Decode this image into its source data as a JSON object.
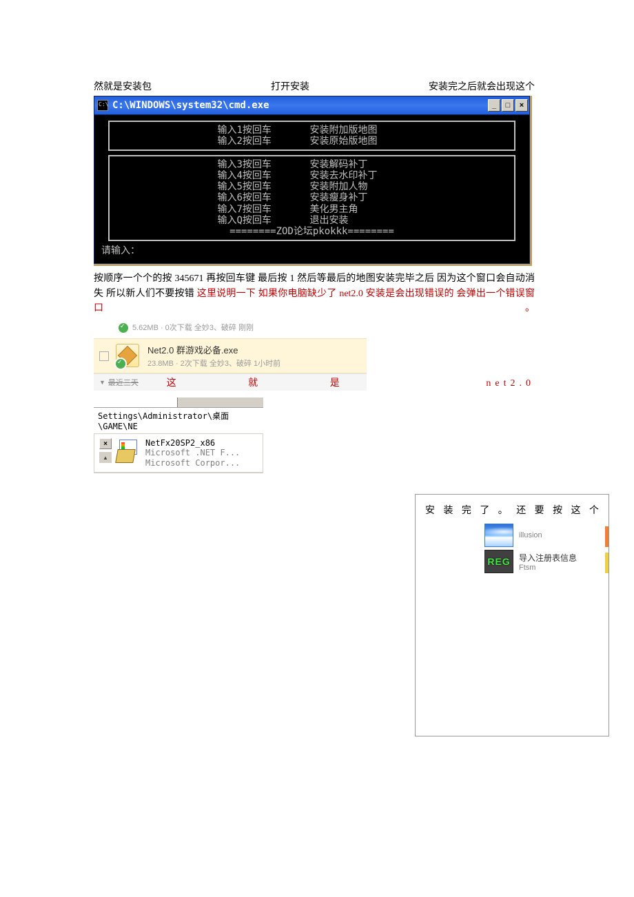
{
  "intro": {
    "seg1": "然就是安装包",
    "seg2": "打开安装",
    "seg3": "安装完之后就会出现这个"
  },
  "cmd": {
    "title": "C:\\WINDOWS\\system32\\cmd.exe",
    "min": "_",
    "max": "□",
    "close": "×",
    "frame1": [
      {
        "l": "输入1按回车",
        "r": "安装附加版地图"
      },
      {
        "l": "输入2按回车",
        "r": "安装原始版地图"
      }
    ],
    "frame2": [
      {
        "l": "输入3按回车",
        "r": "安装解码补丁"
      },
      {
        "l": "输入4按回车",
        "r": "安装去水印补丁"
      },
      {
        "l": "输入5按回车",
        "r": "安装附加人物"
      },
      {
        "l": "输入6按回车",
        "r": "安装瘦身补丁"
      },
      {
        "l": "输入7按回车",
        "r": "美化男主角"
      },
      {
        "l": "输入Q按回车",
        "r": "退出安装"
      }
    ],
    "footer": "========ZOD论坛pkokkk========",
    "prompt": "请输入："
  },
  "para": {
    "black1": "按顺序一个个的按 345671 再按回车键  最后按 1    然后等最后的地图安装完毕之后 因为这个窗口会自动消失  所以新人们不要按错 ",
    "red1": "这里说明一下 如果你电脑缺少了 net2.0   安装是会出现错误的   会弹出一个错误窗口。"
  },
  "dl": {
    "item1_meta": "5.62MB · 0次下载  全妙3、破碎  刚刚",
    "item2_name": "Net2.0 群游戏必备.exe",
    "item2_meta": "23.8MB · 2次下载  全妙3、破碎  1小时前",
    "footer_arrow": "▼",
    "footer_text": "最近三天"
  },
  "net_label": "这就是 net2.0",
  "ext": {
    "path": "Settings\\Administrator\\桌面\\GAME\\NE",
    "name": "NetFx20SP2_x86",
    "sub1": "Microsoft .NET F...",
    "sub2": "Microsoft Corpor...",
    "close": "×",
    "scroll": "▲"
  },
  "right": {
    "head": "安装完了。还要按这个",
    "app1_name": "illusion",
    "app2_name": "导入注册表信息",
    "app2_sub": "Ftsm",
    "reg_label": "REG"
  }
}
